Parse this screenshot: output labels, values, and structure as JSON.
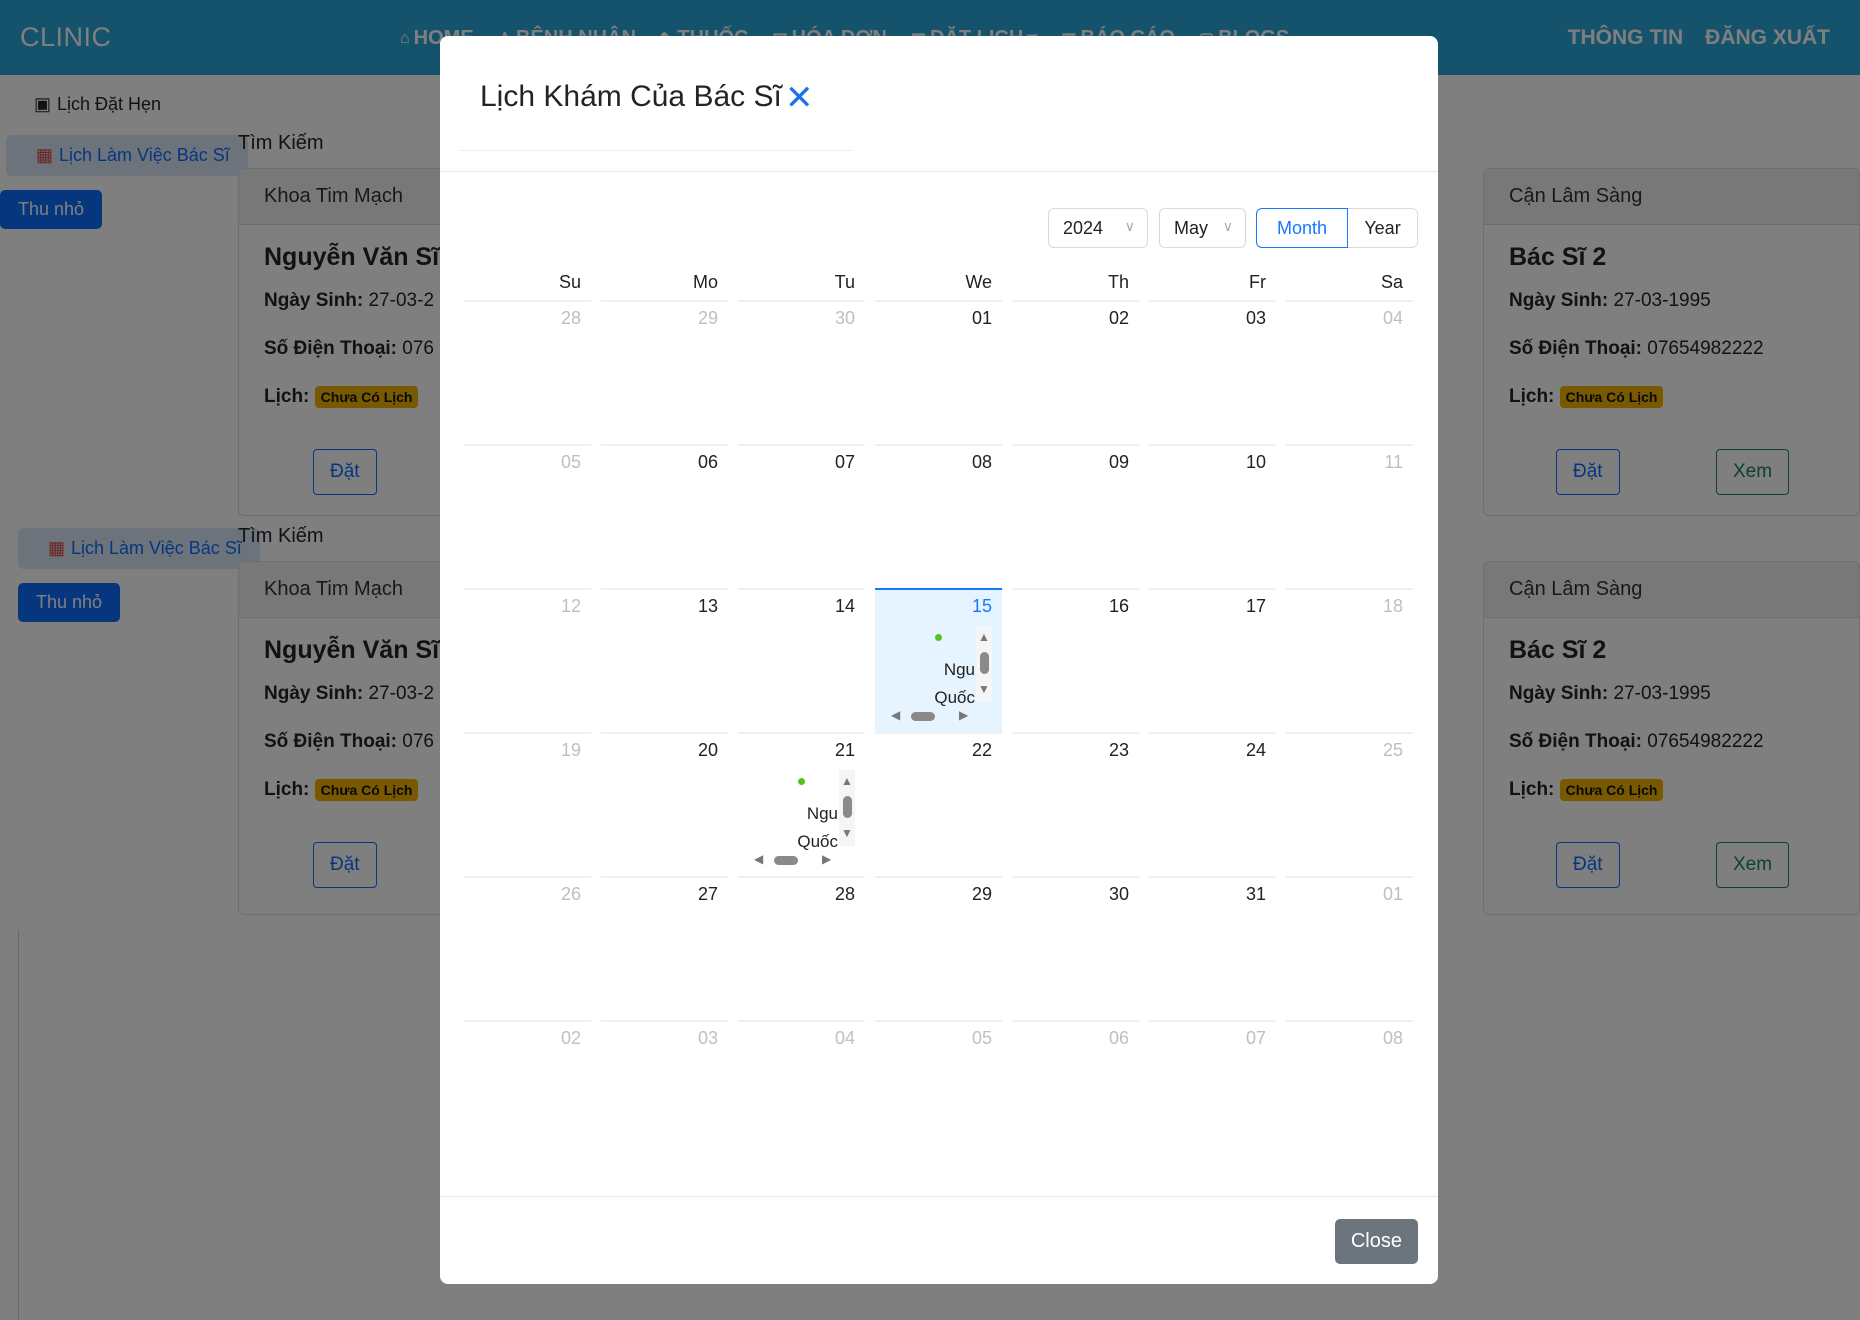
{
  "navbar": {
    "brand": "CLINIC",
    "items": [
      {
        "icon": "home-icon",
        "label": "HOME"
      },
      {
        "icon": "user-icon",
        "label": "BỆNH NHÂN"
      },
      {
        "icon": "pill-icon",
        "label": "THUỐC"
      },
      {
        "icon": "invoice-icon",
        "label": "HÓA ĐƠN"
      },
      {
        "icon": "calendar-icon",
        "label": "ĐẶT LỊCH"
      },
      {
        "icon": "report-icon",
        "label": "BÁO CÁO"
      },
      {
        "icon": "blog-icon",
        "label": "BLOGS"
      }
    ],
    "right": [
      "THÔNG TIN",
      "ĐĂNG XUẤT"
    ]
  },
  "sidebar": {
    "appointment_link": "Lịch Đặt Hẹn",
    "schedule_link": "Lịch Làm Việc Bác Sĩ",
    "collapse_label": "Thu nhỏ"
  },
  "content": {
    "search_label": "Tìm Kiếm",
    "cards": [
      {
        "department": "Khoa Tim Mạch",
        "name": "Nguyễn Văn Sĩ",
        "dob_label": "Ngày Sinh:",
        "dob": "27-03-2",
        "phone_label": "Số Điện Thoại:",
        "phone": "076",
        "schedule_label": "Lịch:",
        "schedule_badge": "Chưa Có Lịch",
        "book_label": "Đặt"
      },
      {
        "department": "Cận Lâm Sàng",
        "name": "Bác Sĩ 2",
        "dob_label": "Ngày Sinh:",
        "dob": "27-03-1995",
        "phone_label": "Số Điện Thoại:",
        "phone": "07654982222",
        "schedule_label": "Lịch:",
        "schedule_badge": "Chưa Có Lịch",
        "book_label": "Đặt",
        "view_label": "Xem"
      }
    ]
  },
  "modal": {
    "title": "Lịch Khám Của Bác Sĩ",
    "year": "2024",
    "month": "May",
    "mode_month": "Month",
    "mode_year": "Year",
    "weekdays": [
      "Su",
      "Mo",
      "Tu",
      "We",
      "Th",
      "Fr",
      "Sa"
    ],
    "weeks": [
      [
        "28",
        "29",
        "30",
        "01",
        "02",
        "03",
        "04"
      ],
      [
        "05",
        "06",
        "07",
        "08",
        "09",
        "10",
        "11"
      ],
      [
        "12",
        "13",
        "14",
        "15",
        "16",
        "17",
        "18"
      ],
      [
        "19",
        "20",
        "21",
        "22",
        "23",
        "24",
        "25"
      ],
      [
        "26",
        "27",
        "28",
        "29",
        "30",
        "31",
        "01"
      ],
      [
        "02",
        "03",
        "04",
        "05",
        "06",
        "07",
        "08"
      ]
    ],
    "event_text_line1": "Ngu",
    "event_text_line2": "Quốc",
    "close_label": "Close"
  }
}
